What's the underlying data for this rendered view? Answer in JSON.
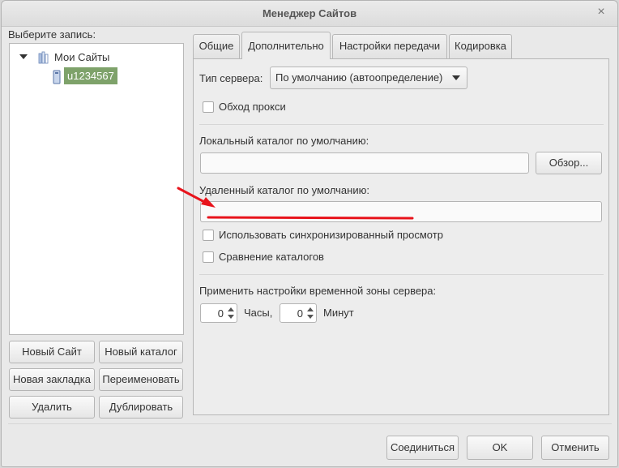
{
  "window": {
    "title": "Менеджер Сайтов",
    "close_glyph": "×"
  },
  "left": {
    "select_label": "Выберите запись:",
    "tree": {
      "root_label": "Мои Сайты",
      "site_label": "u1234567"
    },
    "buttons": {
      "new_site": "Новый Сайт",
      "new_folder": "Новый каталог",
      "new_bookmark": "Новая закладка",
      "rename": "Переименовать",
      "delete": "Удалить",
      "duplicate": "Дублировать"
    }
  },
  "tabs": [
    "Общие",
    "Дополнительно",
    "Настройки передачи",
    "Кодировка"
  ],
  "active_tab": "Дополнительно",
  "advanced": {
    "server_type_label": "Тип сервера:",
    "server_type_value": "По умолчанию (автоопределение)",
    "bypass_proxy_label": "Обход прокси",
    "bypass_proxy_checked": false,
    "local_dir_label": "Локальный каталог по умолчанию:",
    "local_dir_value": "",
    "browse_label": "Обзор...",
    "remote_dir_label": "Удаленный каталог по умолчанию:",
    "remote_dir_value": "",
    "sync_browse_label": "Использовать синхронизированный просмотр",
    "sync_browse_checked": false,
    "dir_compare_label": "Сравнение каталогов",
    "dir_compare_checked": false,
    "timezone_label": "Применить настройки временной зоны сервера:",
    "hours_value": "0",
    "hours_label": "Часы,",
    "minutes_value": "0",
    "minutes_label": "Минут"
  },
  "footer": {
    "connect": "Соединиться",
    "ok": "OK",
    "cancel": "Отменить"
  },
  "colors": {
    "annotation": "#e8141c",
    "selected_site": "#7ea26a"
  },
  "icons": {
    "expand": "triangle-down",
    "root": "folder",
    "site": "server"
  }
}
